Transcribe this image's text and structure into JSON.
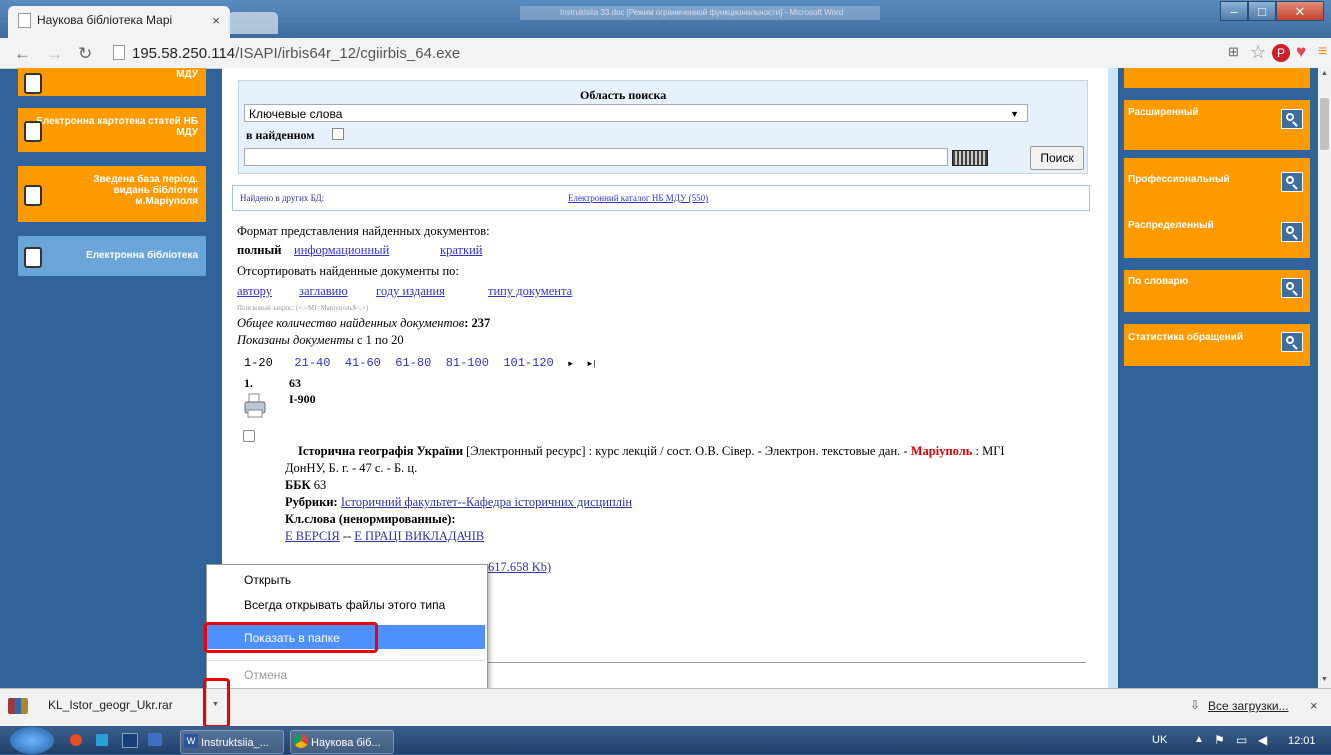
{
  "browser": {
    "tab_title": "Наукова бібліотека Марі",
    "tab_close": "×",
    "background_window_title": "Instruktsiia 33.doc [Режим ограниченной функциональности] - Microsoft Word",
    "url_host": "195.58.250.114",
    "url_path": "/ISAPI/irbis64r_12/cgiirbis_64.exe"
  },
  "left_sidebar": {
    "items": [
      {
        "label": "МДУ"
      },
      {
        "label": "Електронна картотека статей НБ МДУ"
      },
      {
        "label": "Зведена база період. видань бібліотек м.Маріуполя"
      },
      {
        "label": "Електронна бібліотека"
      }
    ]
  },
  "search": {
    "area_label": "Область поиска",
    "select_value": "Ключевые слова",
    "in_found_label": "в найденном",
    "query_value": "",
    "search_button": "Поиск",
    "found_other_db": "Найдено в других БД:",
    "catalog_link": "Електронний каталог НБ МДУ (550)"
  },
  "format": {
    "label": "Формат представления найденных документов:",
    "full": "полный",
    "info": "информационный",
    "short": "краткий",
    "sort_label": "Отсортировать найденные документы по:",
    "sort_author": "автору",
    "sort_title": "заглавию",
    "sort_year": "году издания",
    "sort_type": "типу документа",
    "query_note": "Поисковый запрос: (<.>MI=Маріуполь$<.>)",
    "total_label": "Общее количество найденных документов",
    "total_value": ": 237",
    "shown_label": "Показаны документы",
    "shown_value": "с 1 по 20"
  },
  "pagination": {
    "current": "1-20",
    "pages": [
      "21-40",
      "41-60",
      "61-80",
      "81-100",
      "101-120"
    ],
    "next": "►",
    "last": "►|"
  },
  "record": {
    "num": "1.",
    "code1": "63",
    "code2": "І-900",
    "title_bold": "Історична географія України",
    "title_rest": "[Электронный ресурс] : курс лекцій / сост. О.В. Сівер. - Электрон. текстовые дан. -",
    "city": "Маріуполь",
    "publisher": ": МГІ",
    "line2": "ДонНУ, Б. г. - 47 с. - Б. ц.",
    "bbk_label": "ББК",
    "bbk_value": "63",
    "rubric_label": "Рубрики:",
    "rubric_value": "Історичний факультет--Кафедра історичних дисциплін",
    "kw_label": "Кл.слова (ненормированные):",
    "kw1": "Е ВЕРСІЯ",
    "kw_sep": "--",
    "kw2": "Е ПРАЦІ ВИКЛАДАЧІВ",
    "file_size": "617.658 Kb)"
  },
  "right_sidebar": {
    "items": [
      {
        "label": "Расширенный"
      },
      {
        "label": "Профессиональный"
      },
      {
        "label": "Распределенный"
      },
      {
        "label": "По словарю"
      },
      {
        "label": "Статистика обращений"
      }
    ]
  },
  "context_menu": {
    "open": "Открыть",
    "always_open": "Всегда открывать файлы этого типа",
    "show_in_folder": "Показать в папке",
    "cancel": "Отмена"
  },
  "download_bar": {
    "filename": "KL_Istor_geogr_Ukr.rar",
    "all_downloads": "Все загрузки...",
    "close": "×"
  },
  "taskbar": {
    "word_task": "Instruktsiia_...",
    "chrome_task": "Наукова біб...",
    "lang": "UK",
    "time": "12:01"
  }
}
